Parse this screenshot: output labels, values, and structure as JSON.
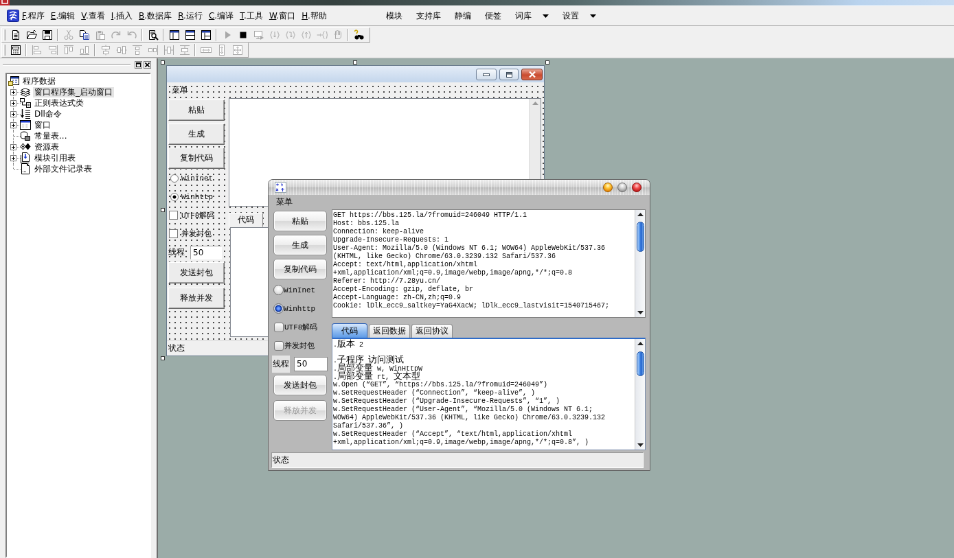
{
  "menu_bar": {
    "items": [
      {
        "label": "F.程序"
      },
      {
        "label": "E.编辑"
      },
      {
        "label": "V.查看"
      },
      {
        "label": "I.插入"
      },
      {
        "label": "B.数据库"
      },
      {
        "label": "R.运行"
      },
      {
        "label": "C.编译"
      },
      {
        "label": "T.工具"
      },
      {
        "label": "W.窗口"
      },
      {
        "label": "H.帮助"
      }
    ],
    "extra_items": [
      {
        "label": "模块",
        "dropdown": false
      },
      {
        "label": "支持库",
        "dropdown": false
      },
      {
        "label": "静编",
        "dropdown": false
      },
      {
        "label": "便签",
        "dropdown": false
      },
      {
        "label": "词库",
        "dropdown": true
      },
      {
        "label": "设置",
        "dropdown": true
      }
    ]
  },
  "toolbars": [
    {
      "groups": [
        [
          {
            "kind": "new",
            "disabled": false
          },
          {
            "kind": "open",
            "disabled": false
          },
          {
            "kind": "save",
            "disabled": false
          }
        ],
        [
          {
            "kind": "cut",
            "disabled": true
          },
          {
            "kind": "copy",
            "disabled": false
          },
          {
            "kind": "paste",
            "disabled": true
          },
          {
            "kind": "redo",
            "disabled": true
          },
          {
            "kind": "undo",
            "disabled": true
          }
        ],
        [
          {
            "kind": "find",
            "disabled": false
          }
        ],
        [
          {
            "kind": "layout_left",
            "disabled": false
          },
          {
            "kind": "layout_top",
            "disabled": false
          },
          {
            "kind": "layout_split",
            "disabled": false
          }
        ],
        [
          {
            "kind": "run",
            "disabled": true
          },
          {
            "kind": "stop",
            "disabled": false
          },
          {
            "kind": "compile",
            "disabled": true
          },
          {
            "kind": "step_into",
            "disabled": true
          },
          {
            "kind": "step_over",
            "disabled": true
          },
          {
            "kind": "step_out",
            "disabled": true
          },
          {
            "kind": "run_to",
            "disabled": true
          },
          {
            "kind": "hand",
            "disabled": true
          }
        ],
        [
          {
            "kind": "help",
            "disabled": false
          }
        ]
      ]
    },
    {
      "groups": [
        [
          {
            "kind": "form",
            "disabled": false
          }
        ],
        [
          {
            "kind": "align_left",
            "disabled": true
          },
          {
            "kind": "align_right",
            "disabled": true
          },
          {
            "kind": "align_top",
            "disabled": true
          },
          {
            "kind": "align_bottom",
            "disabled": true
          }
        ],
        [
          {
            "kind": "center_h",
            "disabled": true
          },
          {
            "kind": "center_v",
            "disabled": true
          },
          {
            "kind": "stack_top",
            "disabled": true
          },
          {
            "kind": "stack_side",
            "disabled": true
          },
          {
            "kind": "space_h",
            "disabled": true
          },
          {
            "kind": "space_v",
            "disabled": true
          }
        ],
        [
          {
            "kind": "same_width",
            "disabled": true
          },
          {
            "kind": "same_height",
            "disabled": true
          },
          {
            "kind": "same_size",
            "disabled": true
          }
        ]
      ]
    }
  ],
  "project_panel": {
    "tree": [
      {
        "label": "程序数据",
        "kind": "program",
        "selected": false,
        "children": [
          {
            "label": "窗口程序集_启动窗口",
            "kind": "module_set",
            "selected": true,
            "expanded": false
          },
          {
            "label": "正则表达式类",
            "kind": "class",
            "selected": false,
            "expanded": false
          },
          {
            "label": "Dll命令",
            "kind": "dll",
            "selected": false,
            "expanded": false
          },
          {
            "label": "窗口",
            "kind": "window",
            "selected": false,
            "expanded": false
          },
          {
            "label": "常量表...",
            "kind": "constants",
            "selected": false
          },
          {
            "label": "资源表",
            "kind": "resources",
            "selected": false,
            "expanded": false
          },
          {
            "label": "模块引用表",
            "kind": "module_ref",
            "selected": false,
            "expanded": false
          },
          {
            "label": "外部文件记录表",
            "kind": "file_list",
            "selected": false
          }
        ]
      }
    ]
  },
  "designer_form": {
    "menu": "菜单",
    "buttons": [
      {
        "label": "粘贴"
      },
      {
        "label": "生成"
      },
      {
        "label": "复制代码"
      }
    ],
    "radios": [
      {
        "label": "WinInet",
        "selected": false
      },
      {
        "label": "Winhttp",
        "selected": true
      }
    ],
    "checkboxes": [
      {
        "label": "UTF8解码",
        "checked": false
      },
      {
        "label": "并发封包",
        "checked": false
      }
    ],
    "thread": {
      "label": "线程",
      "value": "50"
    },
    "action_buttons": [
      {
        "label": "发送封包",
        "disabled": false
      },
      {
        "label": "释放并发",
        "disabled": false
      }
    ],
    "tabs": [
      {
        "label": "代码",
        "selected": true
      }
    ],
    "status": "状态"
  },
  "app_window": {
    "menu": "菜单",
    "buttons": [
      {
        "label": "粘贴"
      },
      {
        "label": "生成"
      },
      {
        "label": "复制代码"
      }
    ],
    "radios": [
      {
        "label": "WinInet",
        "selected": false
      },
      {
        "label": "Winhttp",
        "selected": true
      }
    ],
    "checkboxes": [
      {
        "label": "UTF8解码",
        "checked": false
      },
      {
        "label": "并发封包",
        "checked": false
      }
    ],
    "thread": {
      "label": "线程",
      "value": "50"
    },
    "action_buttons": [
      {
        "label": "发送封包",
        "disabled": false
      },
      {
        "label": "释放并发",
        "disabled": true
      }
    ],
    "request_text": [
      "GET https://bbs.125.la/?fromuid=246049 HTTP/1.1",
      "Host: bbs.125.la",
      "Connection: keep-alive",
      "Upgrade-Insecure-Requests: 1",
      "User-Agent: Mozilla/5.0 (Windows NT 6.1; WOW64) AppleWebKit/537.36",
      "(KHTML, like Gecko) Chrome/63.0.3239.132 Safari/537.36",
      "Accept: text/html,application/xhtml",
      "+xml,application/xml;q=0.9,image/webp,image/apng,*/*;q=0.8",
      "Referer: http://7.28yu.cn/",
      "Accept-Encoding: gzip, deflate, br",
      "Accept-Language: zh-CN,zh;q=0.9",
      "Cookie: lDlk_ecc9_saltkey=YaG4XacW; lDlk_ecc9_lastvisit=1540715467;"
    ],
    "tabs": [
      {
        "label": "代码",
        "selected": true
      },
      {
        "label": "返回数据",
        "selected": false
      },
      {
        "label": "返回协议",
        "selected": false
      }
    ],
    "code": [
      [
        ".版本 2"
      ],
      [
        ".子程序 访问测试",
        ".局部变量 w, WinHttpW",
        ".局部变量 rt, 文本型",
        "w.Open (“GET”, “https://bbs.125.la/?fromuid=246049”)",
        "w.SetRequestHeader (“Connection”, “keep-alive”, )",
        "w.SetRequestHeader (“Upgrade-Insecure-Requests”, “1”, )",
        "w.SetRequestHeader (“User-Agent”, “Mozilla/5.0 (Windows NT 6.1;",
        "WOW64) AppleWebKit/537.36 (KHTML, like Gecko) Chrome/63.0.3239.132",
        "Safari/537.36”, )",
        "w.SetRequestHeader (“Accept”, “text/html,application/xhtml",
        "+xml,application/xml;q=0.9,image/webp,image/apng,*/*;q=0.8”, )"
      ]
    ],
    "status": "状态"
  }
}
